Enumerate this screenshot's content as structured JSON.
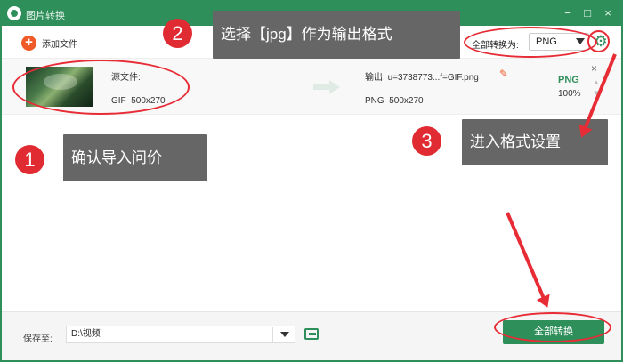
{
  "window": {
    "title": "图片转换"
  },
  "toolbar": {
    "add_file_label": "添加文件",
    "convert_all_label": "全部转换为:",
    "selected_format": "PNG"
  },
  "file": {
    "source_label": "源文件:",
    "source_format": "GIF",
    "source_size": "500x270",
    "output_label": "输出:",
    "output_name": "u=3738773...f=GIF.png",
    "output_format": "PNG",
    "output_size": "500x270",
    "format_badge": "PNG",
    "quality": "100%"
  },
  "bottom": {
    "save_label": "保存至:",
    "save_path": "D:\\视频",
    "convert_button": "全部转换"
  },
  "annotations": [
    {
      "number": "1",
      "text": "确认导入问价"
    },
    {
      "number": "2",
      "text": "选择【jpg】作为输出格式"
    },
    {
      "number": "3",
      "text": "进入格式设置"
    }
  ],
  "colors": {
    "brand": "#2f8f5b",
    "accent": "#f05a28",
    "annotation_red": "#e72c35"
  }
}
